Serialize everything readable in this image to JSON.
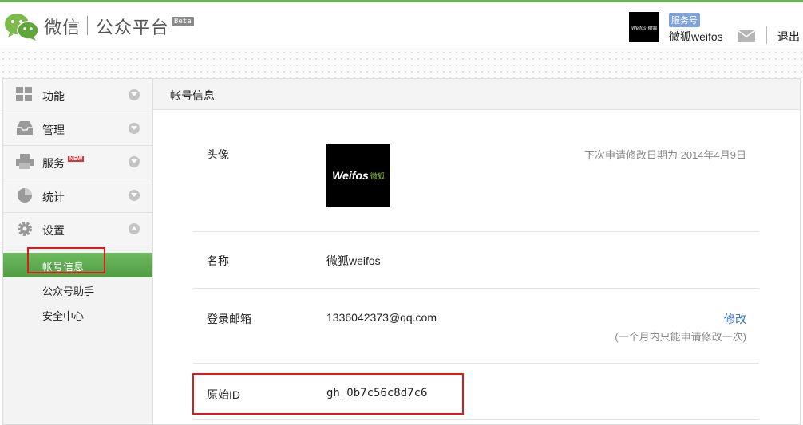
{
  "header": {
    "brand": "微信",
    "product": "公众平台",
    "beta": "Beta",
    "account_type": "服务号",
    "account_name": "微狐weifos",
    "avatar_text": "Weifos 微狐",
    "logout": "退出"
  },
  "sidebar": {
    "items": [
      {
        "label": "功能",
        "icon": "grid-icon"
      },
      {
        "label": "管理",
        "icon": "inbox-icon"
      },
      {
        "label": "服务",
        "icon": "printer-icon",
        "badge": "NEW"
      },
      {
        "label": "统计",
        "icon": "pie-chart-icon"
      },
      {
        "label": "设置",
        "icon": "gear-icon"
      }
    ],
    "sub_items": [
      {
        "label": "帐号信息",
        "active": true
      },
      {
        "label": "公众号助手",
        "active": false
      },
      {
        "label": "安全中心",
        "active": false
      }
    ]
  },
  "main": {
    "title": "帐号信息",
    "avatar": {
      "label": "头像",
      "next_change": "下次申请修改日期为 2014年4月9日",
      "logo_text": "Weifos",
      "logo_sub": "微狐"
    },
    "name": {
      "label": "名称",
      "value": "微狐weifos"
    },
    "email": {
      "label": "登录邮箱",
      "value": "1336042373@qq.com",
      "modify": "修改",
      "note": "(一个月内只能申请修改一次)"
    },
    "original_id": {
      "label": "原始ID",
      "value": "gh_0b7c56c8d7c6"
    }
  },
  "colors": {
    "accent_green": "#6bb35b",
    "link_blue": "#3a73c4",
    "highlight_red": "#e01919"
  }
}
